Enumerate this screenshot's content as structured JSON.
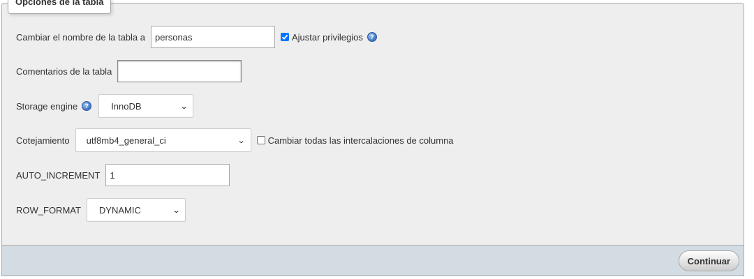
{
  "legend": "Opciones de la tabla",
  "rename": {
    "label": "Cambiar el nombre de la tabla a",
    "value": "personas",
    "checkbox_label": "Ajustar privilegios",
    "checked": true
  },
  "comments": {
    "label": "Comentarios de la tabla",
    "value": ""
  },
  "storage": {
    "label": "Storage engine",
    "selected": "InnoDB"
  },
  "collation": {
    "label": "Cotejamiento",
    "selected": "utf8mb4_general_ci",
    "checkbox_label": "Cambiar todas las intercalaciones de columna",
    "checked": false
  },
  "auto_increment": {
    "label": "AUTO_INCREMENT",
    "value": "1"
  },
  "row_format": {
    "label": "ROW_FORMAT",
    "selected": "DYNAMIC"
  },
  "footer": {
    "continue_label": "Continuar"
  },
  "icons": {
    "help": "help-icon",
    "chevron": "chevron-down-icon",
    "check": "check-icon"
  },
  "colors": {
    "panel_bg": "#eeeeee",
    "footer_bg": "#d3dce3",
    "checkbox_accent": "#0075ff"
  }
}
